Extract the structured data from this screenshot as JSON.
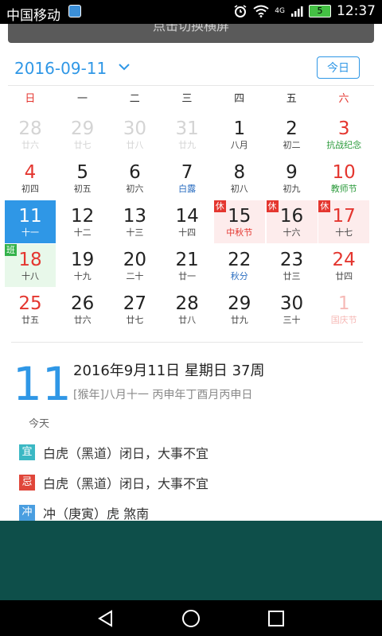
{
  "status": {
    "carrier": "中国移动",
    "network": "4G",
    "battery": "5",
    "time": "12:37"
  },
  "banner": {
    "text": "点击切换横屏"
  },
  "header": {
    "date": "2016-09-11",
    "today_label": "今日"
  },
  "weekdays": [
    "日",
    "一",
    "二",
    "三",
    "四",
    "五",
    "六"
  ],
  "weeks": [
    [
      {
        "d": "28",
        "l": "廿六",
        "faded": true
      },
      {
        "d": "29",
        "l": "廿七",
        "faded": true
      },
      {
        "d": "30",
        "l": "廿八",
        "faded": true
      },
      {
        "d": "31",
        "l": "廿九",
        "faded": true
      },
      {
        "d": "1",
        "l": "八月"
      },
      {
        "d": "2",
        "l": "初二"
      },
      {
        "d": "3",
        "l": "抗战纪念",
        "red": true,
        "lcolor": "green"
      }
    ],
    [
      {
        "d": "4",
        "l": "初四",
        "red": true
      },
      {
        "d": "5",
        "l": "初五"
      },
      {
        "d": "6",
        "l": "初六"
      },
      {
        "d": "7",
        "l": "白露",
        "lcolor": "blue"
      },
      {
        "d": "8",
        "l": "初八"
      },
      {
        "d": "9",
        "l": "初九"
      },
      {
        "d": "10",
        "l": "教师节",
        "red": true,
        "lcolor": "green"
      }
    ],
    [
      {
        "d": "11",
        "l": "十一",
        "selected": true
      },
      {
        "d": "12",
        "l": "十二"
      },
      {
        "d": "13",
        "l": "十三"
      },
      {
        "d": "14",
        "l": "十四"
      },
      {
        "d": "15",
        "l": "中秋节",
        "lcolor": "red",
        "holiday": true,
        "tag": "休"
      },
      {
        "d": "16",
        "l": "十六",
        "holiday": true,
        "tag": "休"
      },
      {
        "d": "17",
        "l": "十七",
        "red": true,
        "holiday": true,
        "tag": "休"
      }
    ],
    [
      {
        "d": "18",
        "l": "十八",
        "red": true,
        "workday": true,
        "tag": "班"
      },
      {
        "d": "19",
        "l": "十九"
      },
      {
        "d": "20",
        "l": "二十"
      },
      {
        "d": "21",
        "l": "廿一"
      },
      {
        "d": "22",
        "l": "秋分",
        "lcolor": "blue"
      },
      {
        "d": "23",
        "l": "廿三"
      },
      {
        "d": "24",
        "l": "廿四",
        "red": true
      }
    ],
    [
      {
        "d": "25",
        "l": "廿五",
        "red": true
      },
      {
        "d": "26",
        "l": "廿六"
      },
      {
        "d": "27",
        "l": "廿七"
      },
      {
        "d": "28",
        "l": "廿八"
      },
      {
        "d": "29",
        "l": "廿九"
      },
      {
        "d": "30",
        "l": "三十"
      },
      {
        "d": "1",
        "l": "国庆节",
        "red": true,
        "faded": true
      }
    ]
  ],
  "detail": {
    "day": "11",
    "line1": "2016年9月11日 星期日 37周",
    "line2": "[猴年]八月十一 丙申年丁酉月丙申日",
    "today": "今天",
    "items": [
      {
        "badge": "宜",
        "text": "白虎（黑道）闭日，大事不宜",
        "color": "#3bb8c4"
      },
      {
        "badge": "忌",
        "text": "白虎（黑道）闭日，大事不宜",
        "color": "#e0463a"
      },
      {
        "badge": "冲",
        "text": "冲（庚寅）虎  煞南",
        "color": "#4a9ee0"
      }
    ]
  },
  "colors": {
    "accent": "#2f97e6",
    "holiday_red": "#e4362f",
    "footer": "#0e4f4a"
  }
}
